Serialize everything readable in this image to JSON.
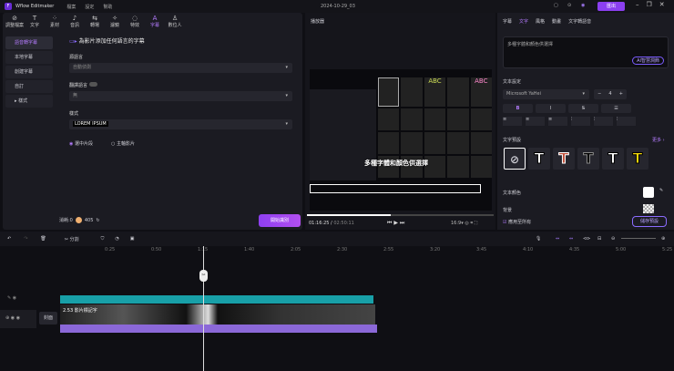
{
  "app": {
    "title": "Wflow Editmaker",
    "menu": [
      "檔案",
      "設定",
      "幫助"
    ],
    "project": "2024-10-29_03",
    "export": "匯出"
  },
  "toolbar": {
    "items": [
      {
        "icon": "adjust-icon",
        "label": "調整檔案"
      },
      {
        "icon": "text-icon",
        "label": "文字"
      },
      {
        "icon": "media-icon",
        "label": "素材"
      },
      {
        "icon": "music-icon",
        "label": "音訊"
      },
      {
        "icon": "transition-icon",
        "label": "轉場"
      },
      {
        "icon": "filter-icon",
        "label": "濾鏡"
      },
      {
        "icon": "effect-icon",
        "label": "特效"
      },
      {
        "icon": "subtitle-icon",
        "label": "字幕"
      },
      {
        "icon": "avatar-icon",
        "label": "數位人"
      }
    ],
    "active": "字幕"
  },
  "sidebar": {
    "items": [
      "語音轉字幕",
      "本地字幕",
      "創建字幕",
      "自訂",
      "樣式"
    ]
  },
  "subtitle_form": {
    "heading": "為影片添加任何語言的字幕",
    "source_label": "源語言",
    "source_value": "自動偵測",
    "translate_label": "翻譯語言",
    "translate_value": "無",
    "style_label": "樣式",
    "style_value": "LOREM IPSUM",
    "radio": [
      "選中片段",
      "主軸影片"
    ],
    "cost_label": "消耗:0",
    "credits": "405",
    "start": "開始識別"
  },
  "player": {
    "title": "播放器",
    "subtitle": "多種字體和顏色供選擇",
    "time_current": "01:16:25",
    "time_total": "02:50:11",
    "ratio": "16:9",
    "progress": 0.45
  },
  "right": {
    "tabs": [
      "字幕",
      "文字",
      "風格",
      "動畫",
      "文字轉語音"
    ],
    "active_tab": "文字",
    "text": "多種字體和顏色供選擇",
    "ai_button": "AI智慧潤飾",
    "text_settings": "文本設定",
    "font": "Microsoft YaHei",
    "size": "4",
    "presets_label": "文字預設",
    "more": "更多",
    "presets": [
      {
        "color": "#ffffff",
        "stroke": "#000000"
      },
      {
        "color": "#c0503a",
        "stroke": "#ffffff"
      },
      {
        "color": "#000000",
        "stroke": "#888888"
      },
      {
        "color": "#ffffff",
        "stroke": "#000000"
      },
      {
        "color": "#f5d90a",
        "stroke": "#000000"
      }
    ],
    "text_color_label": "文本顏色",
    "text_color": "#ffffff",
    "bg_label": "背景",
    "apply_all": "應用至所有",
    "save_preset": "儲存預設"
  },
  "timeline": {
    "split": "分割",
    "ticks": [
      "0:25",
      "0:50",
      "1:15",
      "1:40",
      "2:05",
      "2:30",
      "2:55",
      "3:20",
      "3:45",
      "4:10",
      "4:35",
      "5:00",
      "5:25"
    ],
    "clip_label": "2.53 影片標記字",
    "cover": "封面"
  }
}
